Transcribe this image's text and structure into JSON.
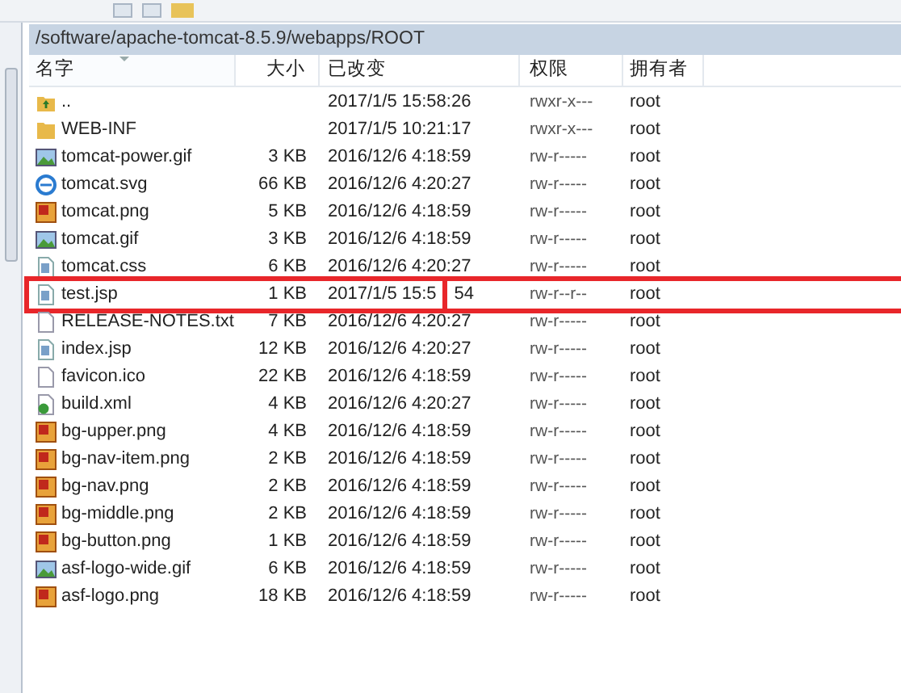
{
  "path_bar": {
    "path": "/software/apache-tomcat-8.5.9/webapps/ROOT"
  },
  "table": {
    "columns": [
      "名字",
      "大小",
      "已改变",
      "权限",
      "拥有者"
    ],
    "rows": [
      {
        "kind": "parent",
        "name": "..",
        "size": "",
        "date": "2017/1/5 15:58:26",
        "perms": "rwxr-x---",
        "owner": "root",
        "highlighted": false
      },
      {
        "kind": "folder",
        "name": "WEB-INF",
        "size": "",
        "date": "2017/1/5 10:21:17",
        "perms": "rwxr-x---",
        "owner": "root",
        "highlighted": false
      },
      {
        "kind": "gif",
        "name": "tomcat-power.gif",
        "size": "3 KB",
        "date": "2016/12/6 4:18:59",
        "perms": "rw-r-----",
        "owner": "root",
        "highlighted": false
      },
      {
        "kind": "svg",
        "name": "tomcat.svg",
        "size": "66 KB",
        "date": "2016/12/6 4:20:27",
        "perms": "rw-r-----",
        "owner": "root",
        "highlighted": false
      },
      {
        "kind": "png",
        "name": "tomcat.png",
        "size": "5 KB",
        "date": "2016/12/6 4:18:59",
        "perms": "rw-r-----",
        "owner": "root",
        "highlighted": false
      },
      {
        "kind": "gif",
        "name": "tomcat.gif",
        "size": "3 KB",
        "date": "2016/12/6 4:18:59",
        "perms": "rw-r-----",
        "owner": "root",
        "highlighted": false
      },
      {
        "kind": "doc",
        "name": "tomcat.css",
        "size": "6 KB",
        "date": "2016/12/6 4:20:27",
        "perms": "rw-r-----",
        "owner": "root",
        "highlighted": false
      },
      {
        "kind": "doc",
        "name": "test.jsp",
        "size": "1 KB",
        "date": "2017/1/5 15:5",
        "date_tail": "54",
        "perms": "rw-r--r--",
        "owner": "root",
        "highlighted": true
      },
      {
        "kind": "blank",
        "name": "RELEASE-NOTES.txt",
        "size": "7 KB",
        "date": "2016/12/6 4:20:27",
        "perms": "rw-r-----",
        "owner": "root",
        "highlighted": false
      },
      {
        "kind": "doc",
        "name": "index.jsp",
        "size": "12 KB",
        "date": "2016/12/6 4:20:27",
        "perms": "rw-r-----",
        "owner": "root",
        "highlighted": false
      },
      {
        "kind": "blank",
        "name": "favicon.ico",
        "size": "22 KB",
        "date": "2016/12/6 4:18:59",
        "perms": "rw-r-----",
        "owner": "root",
        "highlighted": false
      },
      {
        "kind": "xml",
        "name": "build.xml",
        "size": "4 KB",
        "date": "2016/12/6 4:20:27",
        "perms": "rw-r-----",
        "owner": "root",
        "highlighted": false
      },
      {
        "kind": "png",
        "name": "bg-upper.png",
        "size": "4 KB",
        "date": "2016/12/6 4:18:59",
        "perms": "rw-r-----",
        "owner": "root",
        "highlighted": false
      },
      {
        "kind": "png",
        "name": "bg-nav-item.png",
        "size": "2 KB",
        "date": "2016/12/6 4:18:59",
        "perms": "rw-r-----",
        "owner": "root",
        "highlighted": false
      },
      {
        "kind": "png",
        "name": "bg-nav.png",
        "size": "2 KB",
        "date": "2016/12/6 4:18:59",
        "perms": "rw-r-----",
        "owner": "root",
        "highlighted": false
      },
      {
        "kind": "png",
        "name": "bg-middle.png",
        "size": "2 KB",
        "date": "2016/12/6 4:18:59",
        "perms": "rw-r-----",
        "owner": "root",
        "highlighted": false
      },
      {
        "kind": "png",
        "name": "bg-button.png",
        "size": "1 KB",
        "date": "2016/12/6 4:18:59",
        "perms": "rw-r-----",
        "owner": "root",
        "highlighted": false
      },
      {
        "kind": "gif",
        "name": "asf-logo-wide.gif",
        "size": "6 KB",
        "date": "2016/12/6 4:18:59",
        "perms": "rw-r-----",
        "owner": "root",
        "highlighted": false
      },
      {
        "kind": "png",
        "name": "asf-logo.png",
        "size": "18 KB",
        "date": "2016/12/6 4:18:59",
        "perms": "rw-r-----",
        "owner": "root",
        "highlighted": false
      }
    ]
  }
}
